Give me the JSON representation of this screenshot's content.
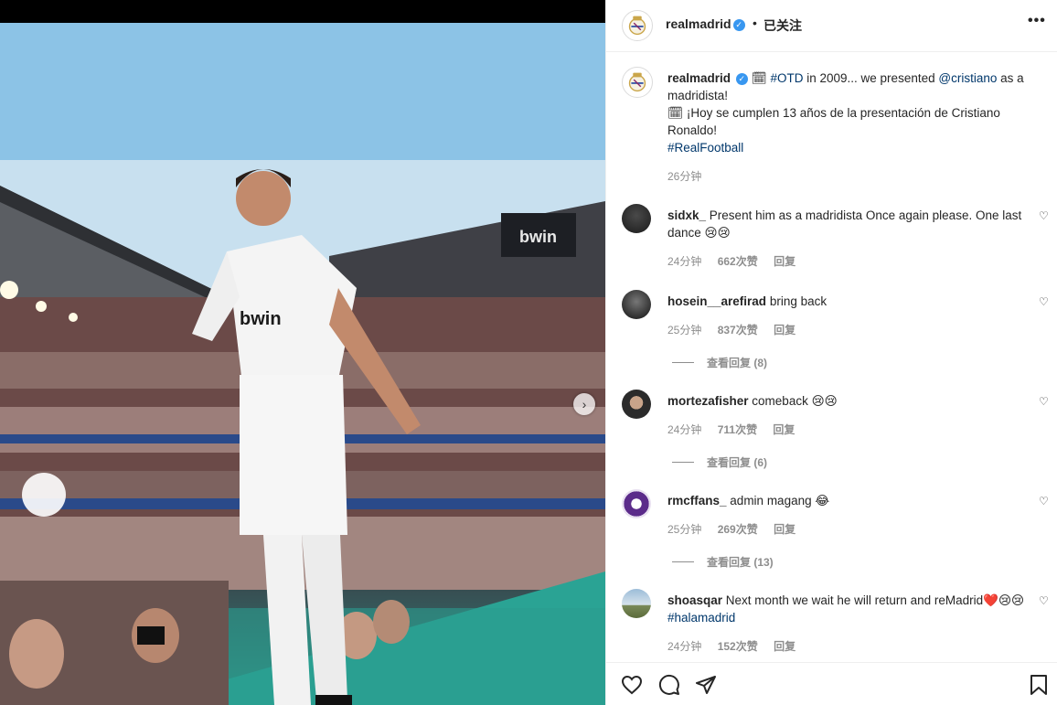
{
  "post": {
    "username": "realmadrid",
    "follow_status": "已关注",
    "separator": "•",
    "more_icon": "more-horizontal-icon",
    "caption": {
      "emoji_1": "🗓",
      "hashtag_otd": "#OTD",
      "text_1": "in 2009... we presented",
      "mention": "@cristiano",
      "text_2": "as a madridista!",
      "emoji_2": "🗓",
      "text_3": "¡Hoy se cumplen 13 años de la presentación de Cristiano Ronaldo!",
      "hashtag_realfootball": "#RealFootball",
      "time": "26分钟"
    }
  },
  "photo": {
    "next_icon": "chevron-right-icon",
    "next_glyph": "›"
  },
  "comments": [
    {
      "user": "sidxk_",
      "text": "Present him as a madridista Once again please. One last dance 😢😢",
      "time": "24分钟",
      "likes": "662次赞",
      "reply": "回复"
    },
    {
      "user": "hosein__arefirad",
      "text": "bring back",
      "time": "25分钟",
      "likes": "837次赞",
      "reply": "回复",
      "view_replies": "查看回复 (8)"
    },
    {
      "user": "mortezafisher",
      "text": "comeback 😢😢",
      "time": "24分钟",
      "likes": "711次赞",
      "reply": "回复",
      "view_replies": "查看回复 (6)"
    },
    {
      "user": "rmcffans_",
      "text": "admin magang 😂",
      "time": "25分钟",
      "likes": "269次赞",
      "reply": "回复",
      "view_replies": "查看回复 (13)"
    },
    {
      "user": "shoasqar",
      "text": "Next month we wait he will return and reMadrid❤️😢😢",
      "hashtag": "#halamadrid",
      "time": "24分钟",
      "likes": "152次赞",
      "reply": "回复"
    }
  ],
  "icons": {
    "heart_glyph": "♡",
    "like": "heart-icon",
    "comment": "comment-icon",
    "share": "share-icon",
    "save": "bookmark-icon",
    "verified": "verified-badge-icon",
    "verified_glyph": "✓"
  },
  "colors": {
    "link": "#00376b",
    "verified": "#3897f0",
    "meta": "#8e8e8e"
  }
}
